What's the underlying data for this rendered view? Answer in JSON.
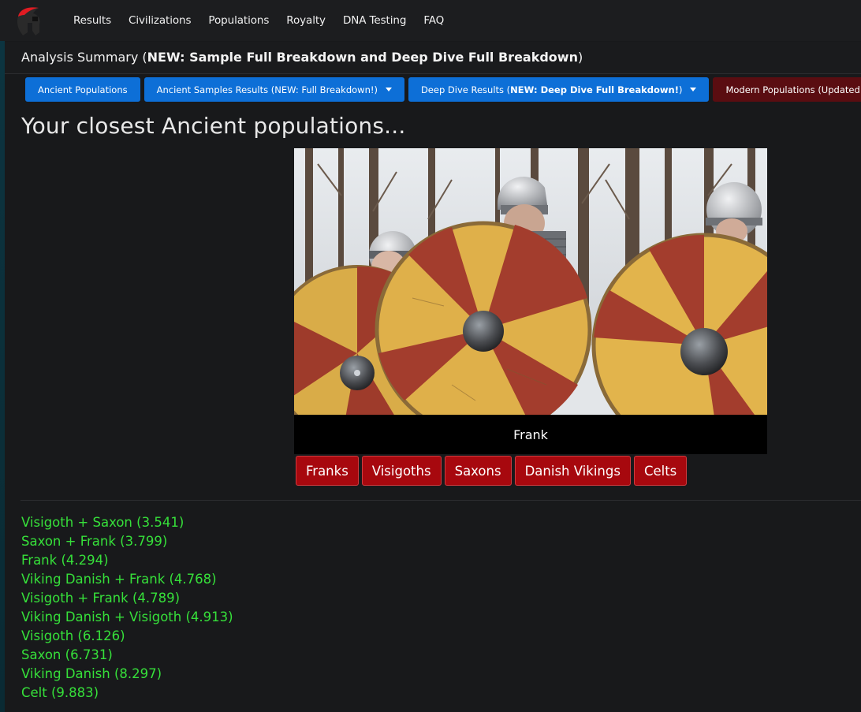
{
  "nav": {
    "logo_icon": "spartan-helmet-icon",
    "links": [
      "Results",
      "Civilizations",
      "Populations",
      "Royalty",
      "DNA Testing",
      "FAQ"
    ]
  },
  "summary": {
    "prefix": "Analysis Summary (",
    "bold": "NEW: Sample Full Breakdown and Deep Dive Full Breakdown",
    "suffix": ")"
  },
  "tabs": {
    "ancient_populations": "Ancient Populations",
    "ancient_samples": "Ancient Samples Results (NEW: Full Breakdown!)",
    "deep_dive_prefix": "Deep Dive Results (",
    "deep_dive_bold": "NEW: Deep Dive Full Breakdown!",
    "deep_dive_suffix": ")",
    "modern_populations": "Modern Populations (Updated!)"
  },
  "heading": "Your closest Ancient populations...",
  "hero": {
    "caption": "Frank"
  },
  "population_buttons": [
    "Franks",
    "Visigoths",
    "Saxons",
    "Danish Vikings",
    "Celts"
  ],
  "results": [
    "Visigoth + Saxon (3.541)",
    "Saxon + Frank (3.799)",
    "Frank (4.294)",
    "Viking Danish + Frank (4.768)",
    "Visigoth + Frank (4.789)",
    "Viking Danish + Visigoth (4.913)",
    "Visigoth (6.126)",
    "Saxon (6.731)",
    "Viking Danish (8.297)",
    "Celt (9.883)"
  ],
  "colors": {
    "accent_blue": "#0d6fd7",
    "button_red": "#a7080e",
    "result_green": "#36e03a"
  }
}
